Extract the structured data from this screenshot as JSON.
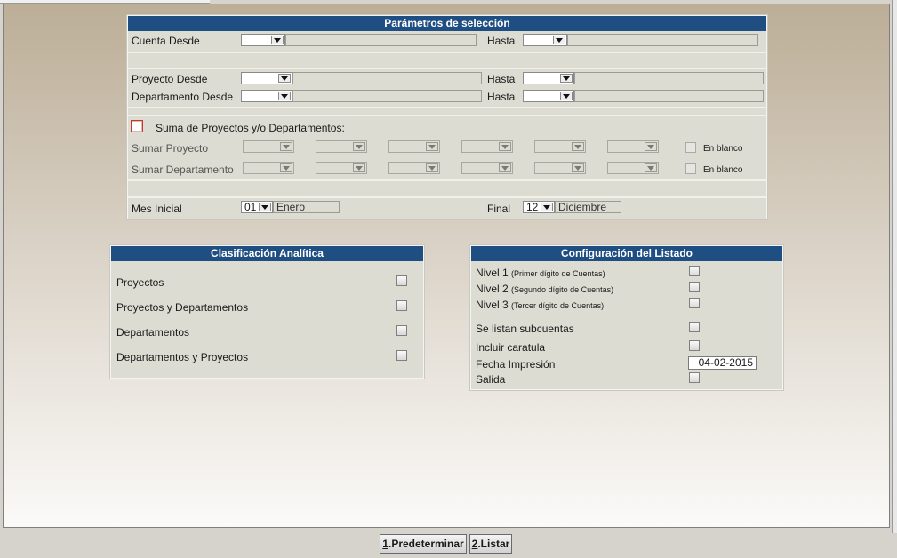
{
  "seleccion": {
    "title": "Parámetros de selección",
    "cuenta_desde": "Cuenta Desde",
    "hasta": "Hasta",
    "proyecto_desde": "Proyecto Desde",
    "departamento_desde": "Departamento Desde",
    "suma_label": "Suma de Proyectos y/o Departamentos:",
    "sumar_proyecto": "Sumar Proyecto",
    "sumar_departamento": "Sumar Departamento",
    "en_blanco": "En blanco",
    "mes_inicial": "Mes Inicial",
    "mes_inicial_num": "01",
    "mes_inicial_nombre": "Enero",
    "final": "Final",
    "mes_final_num": "12",
    "mes_final_nombre": "Diciembre"
  },
  "clasificacion": {
    "title": "Clasificación Analítica",
    "items": [
      "Proyectos",
      "Proyectos y Departamentos",
      "Departamentos",
      "Departamentos y Proyectos"
    ]
  },
  "configuracion": {
    "title": "Configuración del Listado",
    "nivel1": "Nivel 1",
    "nivel1_note": "(Primer dígito de Cuentas)",
    "nivel2": "Nivel 2",
    "nivel2_note": "(Segundo dígito de Cuentas)",
    "nivel3": "Nivel 3",
    "nivel3_note": "(Tercer dígito de Cuentas)",
    "subcuentas": "Se listan subcuentas",
    "caratula": "Incluir caratula",
    "fecha_label": "Fecha Impresión",
    "fecha_value": "04-02-2015",
    "salida": "Salida"
  },
  "buttons": {
    "predeterminar_key": "1",
    "predeterminar_text": ".Predeterminar",
    "listar_key": "2",
    "listar_text": ".Listar"
  }
}
